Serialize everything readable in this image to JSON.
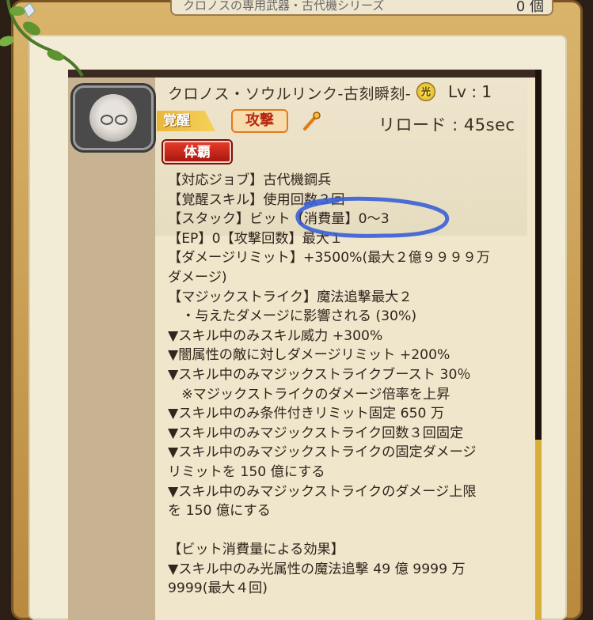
{
  "top_strip": {
    "title": "クロノスの専用武器・古代機シリーズ",
    "count": "0 個"
  },
  "skill": {
    "name": "クロノス・ソウルリンク-古刻瞬刻-",
    "element": "光",
    "level": "Lv : 1",
    "awaken_label": "覚醒",
    "type_label": "攻撃",
    "reload": "リロード : 45sec",
    "stamina_label": "体覇"
  },
  "description": [
    "【対応ジョブ】古代機鋼兵",
    "【覚醒スキル】使用回数３回",
    "【スタック】ビット【消費量】0〜3",
    "【EP】0【攻撃回数】最大１",
    "【ダメージリミット】+3500%(最大２億９９９９万",
    "ダメージ)",
    "【マジックストライク】魔法追撃最大２",
    "　・与えたダメージに影響される (30%)",
    "▼スキル中のみスキル威力 +300%",
    "▼闇属性の敵に対しダメージリミット +200%",
    "▼スキル中のみマジックストライクブースト 30％",
    "　※マジックストライクのダメージ倍率を上昇",
    "▼スキル中のみ条件付きリミット固定 650 万",
    "▼スキル中のみマジックストライク回数３回固定",
    "▼スキル中のみマジックストライクの固定ダメージ",
    "リミットを 150 億にする",
    "▼スキル中のみマジックストライクのダメージ上限",
    "を 150 億にする",
    "",
    "【ビット消費量による効果】",
    "▼スキル中のみ光属性の魔法追撃 49 億 9999 万",
    "9999(最大４回)"
  ],
  "colors": {
    "frame": "#b98a3e",
    "annotation": "#3a5fd6",
    "scroll_thumb": "#d9ae3a"
  },
  "icons": [
    "avatar-portrait",
    "light-element-icon",
    "staff-weapon-icon"
  ]
}
